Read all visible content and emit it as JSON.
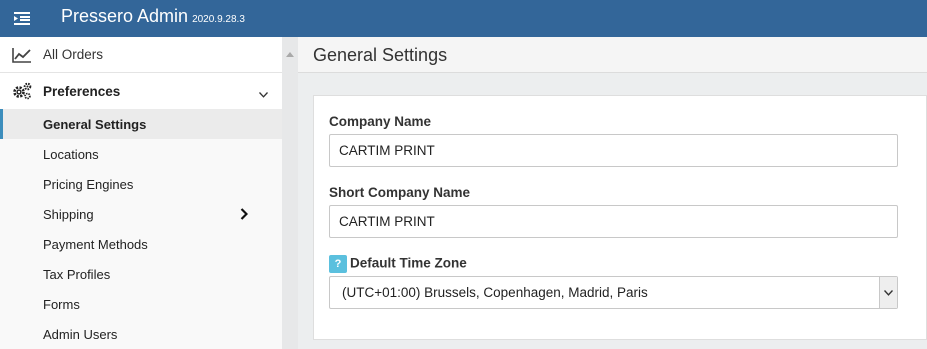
{
  "app": {
    "name": "Pressero Admin",
    "version": "2020.9.28.3"
  },
  "sidebar": {
    "top_item": "All Orders",
    "section": "Preferences",
    "items": [
      {
        "label": "General Settings",
        "active": true
      },
      {
        "label": "Locations"
      },
      {
        "label": "Pricing Engines"
      },
      {
        "label": "Shipping",
        "has_children": true
      },
      {
        "label": "Payment Methods"
      },
      {
        "label": "Tax Profiles"
      },
      {
        "label": "Forms"
      },
      {
        "label": "Admin Users"
      }
    ]
  },
  "page": {
    "title": "General Settings"
  },
  "form": {
    "company_name": {
      "label": "Company Name",
      "value": "CARTIM PRINT"
    },
    "short_company_name": {
      "label": "Short Company Name",
      "value": "CARTIM PRINT"
    },
    "time_zone": {
      "help": "?",
      "label": "Default Time Zone",
      "value": "(UTC+01:00) Brussels, Copenhagen, Madrid, Paris"
    }
  },
  "colors": {
    "topbar": "#336699",
    "active_accent": "#3c8dbc",
    "help_badge": "#5bc0de"
  }
}
